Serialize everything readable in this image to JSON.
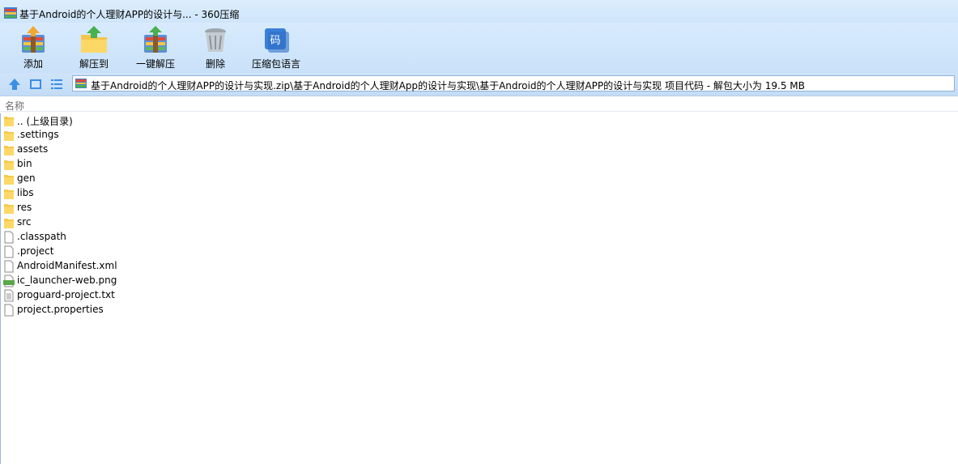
{
  "window": {
    "title": "基于Android的个人理财APP的设计与... - 360压缩"
  },
  "toolbar": {
    "add_label": "添加",
    "extract_to_label": "解压到",
    "one_click_extract_label": "一键解压",
    "delete_label": "删除",
    "language_label": "压缩包语言"
  },
  "address": {
    "path": "基于Android的个人理财APP的设计与实现.zip\\基于Android的个人理财App的设计与实现\\基于Android的个人理财APP的设计与实现 项目代码 - 解包大小为 19.5 MB"
  },
  "list": {
    "column_name": "名称",
    "items": [
      {
        "name": ".. (上级目录)",
        "type": "folder"
      },
      {
        "name": ".settings",
        "type": "folder"
      },
      {
        "name": "assets",
        "type": "folder"
      },
      {
        "name": "bin",
        "type": "folder"
      },
      {
        "name": "gen",
        "type": "folder"
      },
      {
        "name": "libs",
        "type": "folder"
      },
      {
        "name": "res",
        "type": "folder"
      },
      {
        "name": "src",
        "type": "folder"
      },
      {
        "name": ".classpath",
        "type": "file"
      },
      {
        "name": ".project",
        "type": "file"
      },
      {
        "name": "AndroidManifest.xml",
        "type": "file"
      },
      {
        "name": "ic_launcher-web.png",
        "type": "png"
      },
      {
        "name": "proguard-project.txt",
        "type": "text"
      },
      {
        "name": "project.properties",
        "type": "file"
      }
    ]
  },
  "colors": {
    "toolbar_bg": "#d8ebfd",
    "folder": "#f7c948",
    "accent": "#3a8ee6"
  }
}
